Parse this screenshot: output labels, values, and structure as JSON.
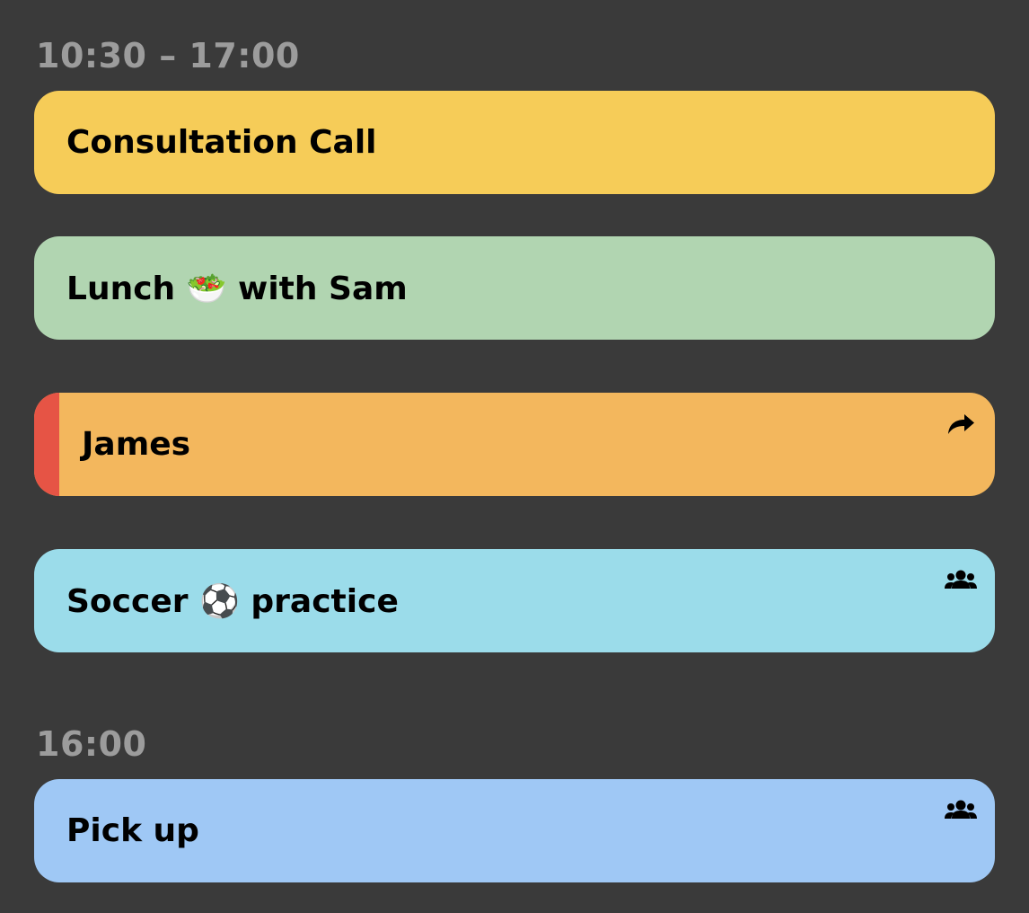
{
  "sections": [
    {
      "time": "10:30 – 17:00"
    },
    {
      "time": "16:00"
    }
  ],
  "events": [
    {
      "title": "Consultation Call",
      "color": "#f6cc58",
      "icon": null
    },
    {
      "title": "Lunch 🥗 with Sam",
      "color": "#b1d5b1",
      "icon": null
    },
    {
      "title": "James",
      "color": "#f3b75d",
      "stripe_color": "#e65445",
      "icon": "share-arrow-icon"
    },
    {
      "title": "Soccer ⚽ practice",
      "color": "#9bdcea",
      "icon": "group-icon"
    },
    {
      "title": "Pick up",
      "color": "#9fc8f5",
      "icon": "group-icon"
    }
  ]
}
